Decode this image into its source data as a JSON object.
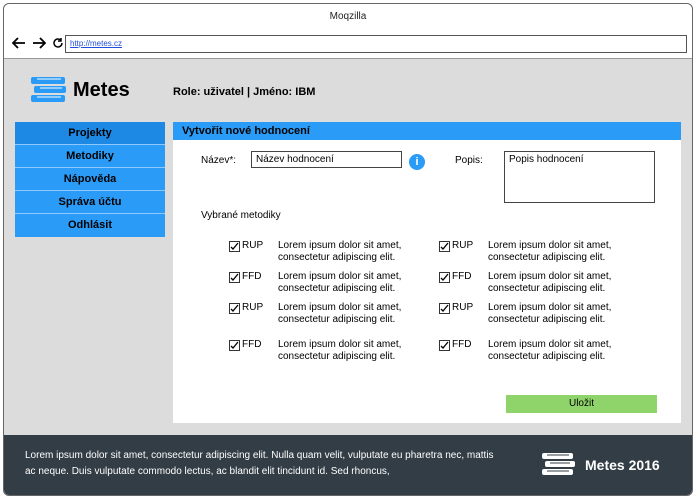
{
  "browser": {
    "title": "Moqzilla",
    "url": "http://metes.cz"
  },
  "header": {
    "brand": "Metes",
    "role": "Role: uživatel | Jméno: IBM"
  },
  "sidebar": {
    "items": [
      {
        "label": "Projekty"
      },
      {
        "label": "Metodiky"
      },
      {
        "label": "Nápověda"
      },
      {
        "label": "Správa účtu"
      },
      {
        "label": "Odhlásit"
      }
    ]
  },
  "form": {
    "heading": "Vytvořit nové hodnocení",
    "name_label": "Název*:",
    "name_value": "Název hodnocení",
    "description_label": "Popis:",
    "description_value": "Popis hodnocení",
    "methods_label": "Vybrané metodiky",
    "methods": [
      {
        "name": "RUP",
        "desc": "Lorem ipsum dolor sit amet, consectetur adipiscing elit."
      },
      {
        "name": "RUP",
        "desc": "Lorem ipsum dolor sit amet, consectetur adipiscing elit."
      },
      {
        "name": "FFD",
        "desc": "Lorem ipsum dolor sit amet, consectetur adipiscing elit."
      },
      {
        "name": "FFD",
        "desc": "Lorem ipsum dolor sit amet, consectetur adipiscing elit."
      },
      {
        "name": "RUP",
        "desc": "Lorem ipsum dolor sit amet, consectetur adipiscing elit."
      },
      {
        "name": "RUP",
        "desc": "Lorem ipsum dolor sit amet, consectetur adipiscing elit."
      },
      {
        "name": "FFD",
        "desc": "Lorem ipsum dolor sit amet, consectetur adipiscing elit."
      },
      {
        "name": "FFD",
        "desc": "Lorem ipsum dolor sit amet, consectetur adipiscing elit."
      }
    ],
    "save_label": "Uložit"
  },
  "footer": {
    "text": "Lorem ipsum dolor sit amet, consectetur adipiscing elit. Nulla quam velit, vulputate eu pharetra nec, mattis ac neque. Duis vulputate commodo lectus, ac blandit elit tincidunt id. Sed rhoncus,",
    "brand": "Metes 2016"
  }
}
